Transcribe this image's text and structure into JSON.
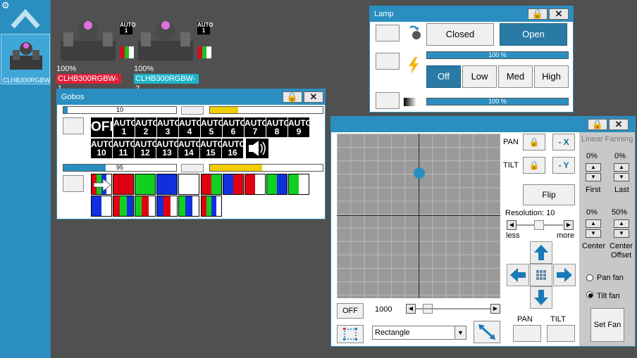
{
  "sidebar": {
    "selected_fixture_label": "CLHB300RGBW"
  },
  "fixtures": [
    {
      "name": "CLHB300RGBW-1",
      "dimmer": "100%",
      "badge_top": "AUTO",
      "badge_bottom": "1",
      "name_color": "#e0203a"
    },
    {
      "name": "CLHB300RGBW-2",
      "dimmer": "100%",
      "badge_top": "AUTO",
      "badge_bottom": "1",
      "name_color": "#1fb3c8"
    }
  ],
  "gobos": {
    "title": "Gobos",
    "bar1_value": "10",
    "bar2_value": "95",
    "off_label": "OFF",
    "auto_cells": [
      {
        "top": "AUTO",
        "bottom": "1"
      },
      {
        "top": "AUTO",
        "bottom": "2"
      },
      {
        "top": "AUTO",
        "bottom": "3"
      },
      {
        "top": "AUTO",
        "bottom": "4"
      },
      {
        "top": "AUTO",
        "bottom": "5"
      },
      {
        "top": "AUTO",
        "bottom": "6"
      },
      {
        "top": "AUTO",
        "bottom": "7"
      },
      {
        "top": "AUTO",
        "bottom": "8"
      },
      {
        "top": "AUTO",
        "bottom": "9"
      },
      {
        "top": "AUTO",
        "bottom": "10"
      },
      {
        "top": "AUTO",
        "bottom": "11"
      },
      {
        "top": "AUTO",
        "bottom": "12"
      },
      {
        "top": "AUTO",
        "bottom": "13"
      },
      {
        "top": "AUTO",
        "bottom": "14"
      },
      {
        "top": "AUTO",
        "bottom": "15"
      },
      {
        "top": "AUTO",
        "bottom": "16"
      }
    ]
  },
  "lamp": {
    "title": "Lamp",
    "closed_label": "Closed",
    "open_label": "Open",
    "bar1_value": "100 %",
    "bar2_value": "100 %",
    "power_options": [
      "Off",
      "Low",
      "Med",
      "High"
    ],
    "selected_power": "Off"
  },
  "pantilt": {
    "pan_label": "PAN",
    "tilt_label": "TILT",
    "invert_x_label": "- X",
    "invert_y_label": "- Y",
    "flip_label": "Flip",
    "resolution_label": "Resolution: 10",
    "less_label": "less",
    "more_label": "more",
    "off_label": "OFF",
    "speed_value": "1000",
    "shape_selected": "Rectangle",
    "pan_bottom_label": "PAN",
    "tilt_bottom_label": "TILT",
    "fanning": {
      "title": "Linear Fanning",
      "first_value": "0%",
      "last_value": "0%",
      "first_label": "First",
      "last_label": "Last",
      "center_value": "0%",
      "center_offset_value": "50%",
      "center_label": "Center",
      "center_offset_label_1": "Center",
      "center_offset_label_2": "Offset",
      "pan_fan_label": "Pan fan",
      "tilt_fan_label": "Tilt fan",
      "selected_fan": "Tilt fan",
      "set_fan_label": "Set Fan"
    }
  },
  "colors": {
    "accent": "#2a8fc0",
    "gobo_bar_yellow": "#f2cd00"
  }
}
